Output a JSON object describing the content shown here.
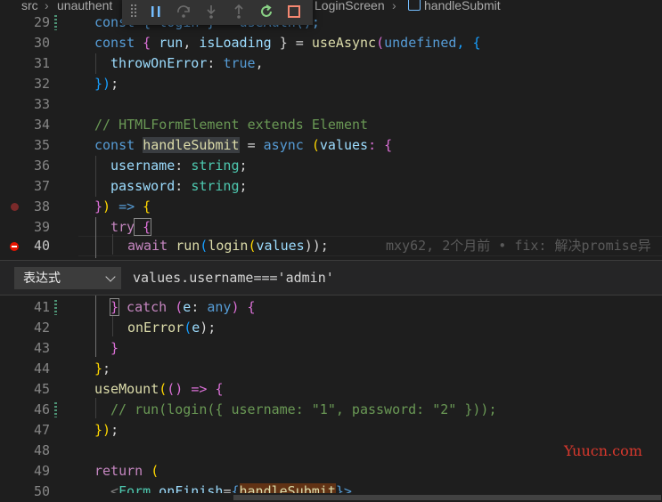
{
  "breadcrumb": {
    "part1": "src",
    "sep": "›",
    "part2": "unauthent",
    "part3": "LoginScreen",
    "part4": "handleSubmit"
  },
  "debug_toolbar": {
    "actions": [
      "continue",
      "step-over",
      "step-into",
      "step-out",
      "restart",
      "stop"
    ]
  },
  "breakpoint_editor": {
    "type_label": "表达式",
    "expression": "values.username==='admin'"
  },
  "blame": "mxy62, 2个月前 • fix: 解决promise异",
  "line_numbers": [
    "29",
    "30",
    "31",
    "32",
    "33",
    "34",
    "35",
    "36",
    "37",
    "38",
    "39",
    "40",
    "41",
    "42",
    "43",
    "44",
    "45",
    "46",
    "47",
    "48",
    "49",
    "50"
  ],
  "code": {
    "l29a": "const { login } = useAuth();",
    "l30a": "const",
    "l30b": " { ",
    "l30c": "run",
    "l30d": ", ",
    "l30e": "isLoading",
    "l30f": " } = ",
    "l30g": "useAsync",
    "l30h": "(",
    "l30i": "undefined",
    "l30j": ", {",
    "l31a": "throwOnError",
    "l31b": ": ",
    "l31c": "true",
    "l31d": ",",
    "l32a": "})",
    "l32b": ";",
    "l34": "// HTMLFormElement extends Element",
    "l35a": "const ",
    "l35b": "handleSubmit",
    "l35c": " = ",
    "l35d": "async",
    "l35e": " (",
    "l35f": "values",
    "l35g": ": {",
    "l36a": "username",
    "l36b": ": ",
    "l36c": "string",
    "l36d": ";",
    "l37a": "password",
    "l37b": ": ",
    "l37c": "string",
    "l37d": ";",
    "l38a": "}",
    "l38b": ") ",
    "l38c": "=>",
    "l38d": " {",
    "l39a": "try",
    "l39b": " {",
    "l40a": "await",
    "l40b": " ",
    "l40c": "run",
    "l40d": "(",
    "l40e": "login",
    "l40f": "(",
    "l40g": "values",
    "l40h": "));",
    "l41a": "}",
    "l41b": " catch",
    "l41c": " (",
    "l41d": "e",
    "l41e": ": ",
    "l41f": "any",
    "l41g": ") {",
    "l42a": "onError",
    "l42b": "(",
    "l42c": "e",
    "l42d": ");",
    "l43": "}",
    "l44a": "}",
    "l44b": ";",
    "l45a": "useMount",
    "l45b": "(",
    "l45c": "()",
    "l45d": " => {",
    "l46": "// run(login({ username: \"1\", password: \"2\" }));",
    "l47a": "})",
    "l47b": ";",
    "l49a": "return",
    "l49b": " (",
    "l50a": "<",
    "l50b": "Form",
    "l50c": " onFinish",
    "l50d": "=",
    "l50e": "{",
    "l50f": "handleSubmit",
    "l50g": "}>"
  },
  "watermark": "Yuucn.com",
  "colors": {
    "background": "#1e1e1e",
    "breakpoint": "#e51400",
    "keyword": "#569cd6",
    "function": "#dcdcaa"
  }
}
